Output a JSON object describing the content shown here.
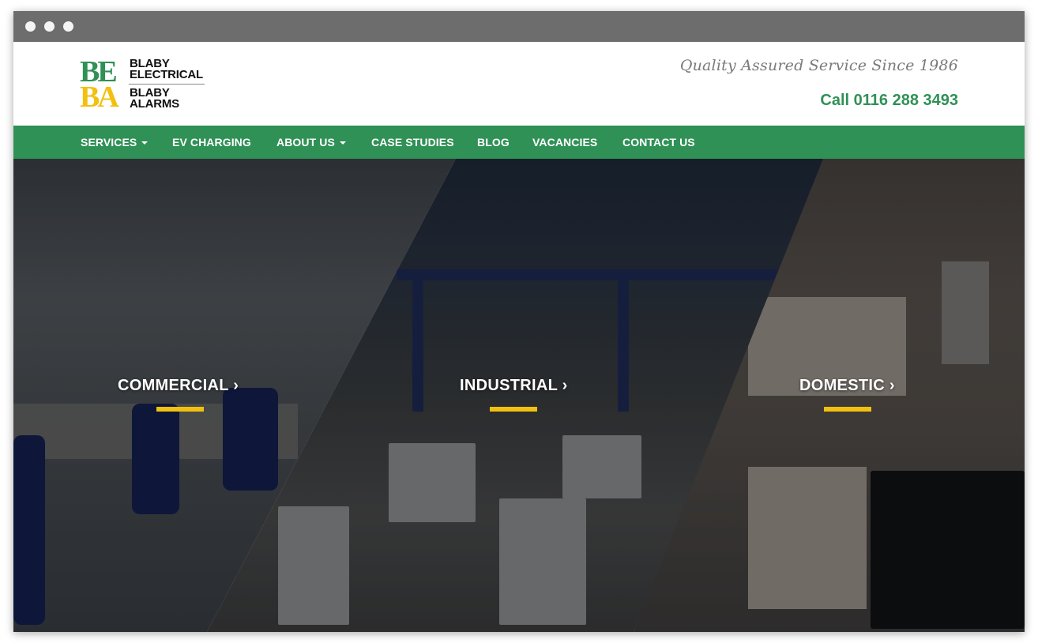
{
  "logo": {
    "mark_top": "BE",
    "mark_bottom": "BA",
    "line1": "BLABY",
    "line2": "ELECTRICAL",
    "line3": "BLABY",
    "line4": "ALARMS"
  },
  "header": {
    "tagline": "Quality Assured Service Since 1986",
    "phone": "Call 0116 288 3493"
  },
  "nav": {
    "items": [
      {
        "label": "SERVICES",
        "dropdown": true
      },
      {
        "label": "EV CHARGING",
        "dropdown": false
      },
      {
        "label": "ABOUT US",
        "dropdown": true
      },
      {
        "label": "CASE STUDIES",
        "dropdown": false
      },
      {
        "label": "BLOG",
        "dropdown": false
      },
      {
        "label": "VACANCIES",
        "dropdown": false
      },
      {
        "label": "CONTACT US",
        "dropdown": false
      }
    ]
  },
  "hero": {
    "commercial": "COMMERCIAL ›",
    "industrial": "INDUSTRIAL ›",
    "domestic": "DOMESTIC ›"
  },
  "colors": {
    "brand_green": "#2f9155",
    "accent_yellow": "#f2c00f",
    "titlebar": "#6d6d6d"
  }
}
